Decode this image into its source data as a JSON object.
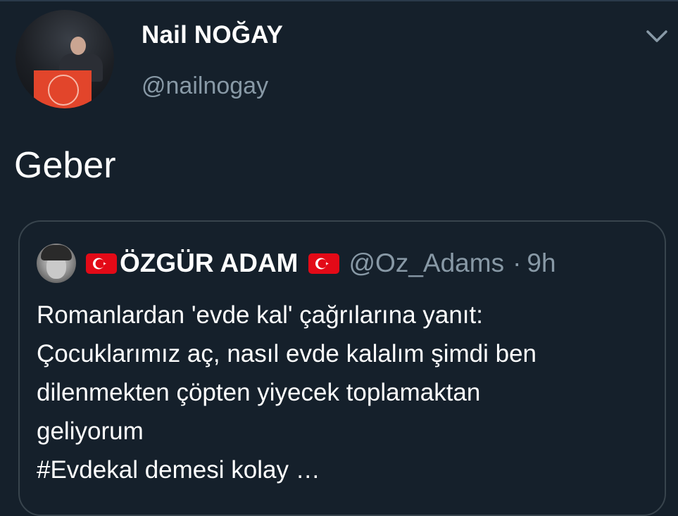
{
  "tweet": {
    "author": {
      "display_name": "Nail NOĞAY",
      "handle": "@nailnogay",
      "avatar": "speaker-at-red-podium"
    },
    "text": "Geber",
    "menu_icon": "chevron-down-icon"
  },
  "quoted_tweet": {
    "author": {
      "flag_left": "turkey-flag-icon",
      "display_name": "ÖZGÜR ADAM",
      "flag_right": "turkey-flag-icon",
      "handle": "@Oz_Adams",
      "separator": "·",
      "time": "9h",
      "avatar": "person-portrait"
    },
    "lines": [
      "Romanlardan 'evde kal' çağrılarına yanıt:",
      "Çocuklarımız aç, nasıl evde kalalım şimdi ben",
      "dilenmekten çöpten yiyecek toplamaktan",
      "geliyorum",
      "#Evdekal demesi kolay …"
    ]
  },
  "colors": {
    "background": "#15202b",
    "secondary_text": "#8899a6",
    "border": "#38444d",
    "flag_red": "#e30a17"
  }
}
